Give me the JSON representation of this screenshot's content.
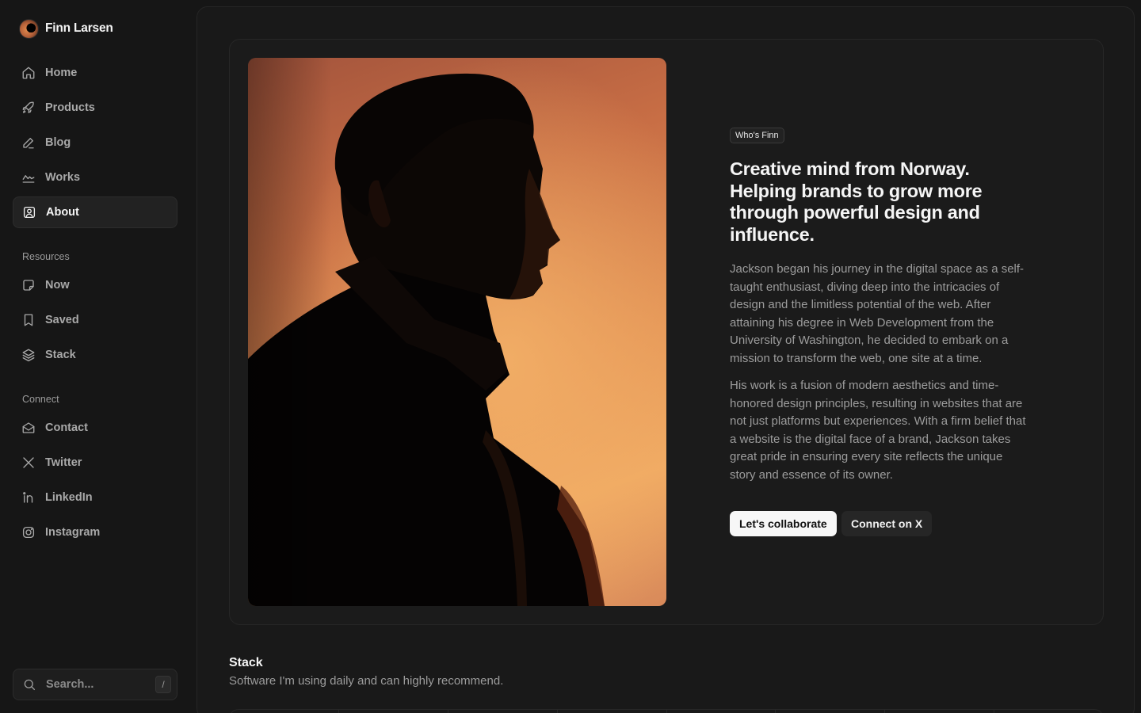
{
  "brand": {
    "name": "Finn Larsen"
  },
  "nav": {
    "main": [
      {
        "label": "Home",
        "icon": "home-icon"
      },
      {
        "label": "Products",
        "icon": "rocket-icon"
      },
      {
        "label": "Blog",
        "icon": "pen-icon"
      },
      {
        "label": "Works",
        "icon": "chart-line-icon"
      },
      {
        "label": "About",
        "icon": "user-square-icon",
        "active": true
      }
    ],
    "resources_label": "Resources",
    "resources": [
      {
        "label": "Now",
        "icon": "note-icon"
      },
      {
        "label": "Saved",
        "icon": "bookmark-icon"
      },
      {
        "label": "Stack",
        "icon": "layers-icon"
      }
    ],
    "connect_label": "Connect",
    "connect": [
      {
        "label": "Contact",
        "icon": "mail-open-icon"
      },
      {
        "label": "Twitter",
        "icon": "x-logo-icon"
      },
      {
        "label": "LinkedIn",
        "icon": "linkedin-icon"
      },
      {
        "label": "Instagram",
        "icon": "instagram-icon"
      }
    ]
  },
  "search": {
    "placeholder": "Search...",
    "shortcut": "/"
  },
  "hero": {
    "badge": "Who's Finn",
    "headline": "Creative mind from Norway. Helping brands to grow more through powerful design and influence.",
    "paragraphs": [
      "Jackson began his journey in the digital space as a self-taught enthusiast, diving deep into the intricacies of design and the limitless potential of the web. After attaining his degree in Web Development from the University of Washington, he decided to embark on a mission to transform the web, one site at a time.",
      "His work is a fusion of modern aesthetics and time-honored design principles, resulting in websites that are not just platforms but experiences. With a firm belief that a website is the digital face of a brand, Jackson takes great pride in ensuring every site reflects the unique story and essence of its owner."
    ],
    "primary_button": "Let's collaborate",
    "secondary_button": "Connect on X"
  },
  "stack": {
    "title": "Stack",
    "subtitle": "Software I'm using daily and can highly recommend."
  },
  "colors": {
    "background": "#161616",
    "panel": "#191919",
    "accent_orange": "#e39356"
  }
}
